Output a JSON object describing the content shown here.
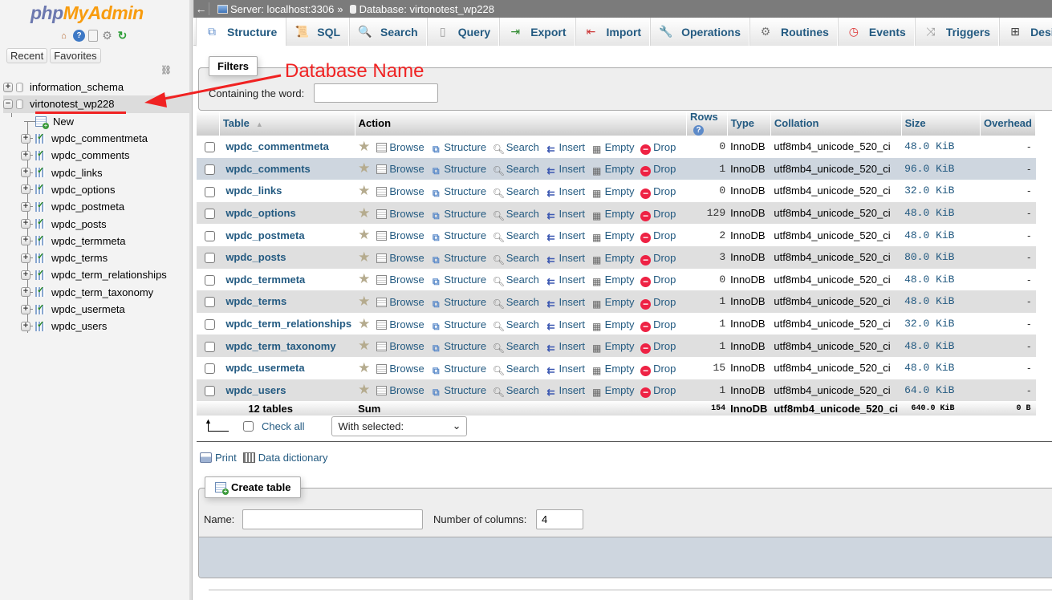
{
  "nav": {
    "logo_php": "php",
    "logo_myadmin": "MyAdmin",
    "icons": [
      "home-icon",
      "help-icon",
      "docs-icon",
      "settings-gear-icon",
      "reload-icon"
    ],
    "tabs": {
      "recent": "Recent",
      "favorites": "Favorites"
    },
    "databases": [
      {
        "name": "information_schema",
        "expanded": false
      },
      {
        "name": "virtonotest_wp228",
        "expanded": true,
        "selected": true
      }
    ],
    "new_label": "New",
    "tables": [
      "wpdc_commentmeta",
      "wpdc_comments",
      "wpdc_links",
      "wpdc_options",
      "wpdc_postmeta",
      "wpdc_posts",
      "wpdc_termmeta",
      "wpdc_terms",
      "wpdc_term_relationships",
      "wpdc_term_taxonomy",
      "wpdc_usermeta",
      "wpdc_users"
    ]
  },
  "breadcrumb": {
    "back": "←",
    "server": "Server: localhost:3306",
    "separator": "»",
    "database": "Database: virtonotest_wp228"
  },
  "tabs": [
    {
      "label": "Structure",
      "icon": "⧉",
      "active": true
    },
    {
      "label": "SQL",
      "icon": "📜"
    },
    {
      "label": "Search",
      "icon": "🔍"
    },
    {
      "label": "Query",
      "icon": "▯"
    },
    {
      "label": "Export",
      "icon": "⇥"
    },
    {
      "label": "Import",
      "icon": "⇤"
    },
    {
      "label": "Operations",
      "icon": "🔧"
    },
    {
      "label": "Routines",
      "icon": "⚙"
    },
    {
      "label": "Events",
      "icon": "◷"
    },
    {
      "label": "Triggers",
      "icon": "⤨"
    },
    {
      "label": "Designer",
      "icon": "⊞"
    }
  ],
  "filters": {
    "legend": "Filters",
    "label": "Containing the word:",
    "value": ""
  },
  "table": {
    "headers": {
      "table": "Table",
      "sort_indicator": "▲",
      "action": "Action",
      "rows": "Rows",
      "rows_help": "?",
      "type": "Type",
      "collation": "Collation",
      "size": "Size",
      "overhead": "Overhead"
    },
    "actions": {
      "browse": "Browse",
      "structure": "Structure",
      "search": "Search",
      "insert": "Insert",
      "empty": "Empty",
      "drop": "Drop"
    },
    "rows": [
      {
        "name": "wpdc_commentmeta",
        "rows": "0",
        "type": "InnoDB",
        "collation": "utf8mb4_unicode_520_ci",
        "size": "48.0 KiB",
        "overhead": "-"
      },
      {
        "name": "wpdc_comments",
        "rows": "1",
        "type": "InnoDB",
        "collation": "utf8mb4_unicode_520_ci",
        "size": "96.0 KiB",
        "overhead": "-"
      },
      {
        "name": "wpdc_links",
        "rows": "0",
        "type": "InnoDB",
        "collation": "utf8mb4_unicode_520_ci",
        "size": "32.0 KiB",
        "overhead": "-"
      },
      {
        "name": "wpdc_options",
        "rows": "129",
        "type": "InnoDB",
        "collation": "utf8mb4_unicode_520_ci",
        "size": "48.0 KiB",
        "overhead": "-"
      },
      {
        "name": "wpdc_postmeta",
        "rows": "2",
        "type": "InnoDB",
        "collation": "utf8mb4_unicode_520_ci",
        "size": "48.0 KiB",
        "overhead": "-"
      },
      {
        "name": "wpdc_posts",
        "rows": "3",
        "type": "InnoDB",
        "collation": "utf8mb4_unicode_520_ci",
        "size": "80.0 KiB",
        "overhead": "-"
      },
      {
        "name": "wpdc_termmeta",
        "rows": "0",
        "type": "InnoDB",
        "collation": "utf8mb4_unicode_520_ci",
        "size": "48.0 KiB",
        "overhead": "-"
      },
      {
        "name": "wpdc_terms",
        "rows": "1",
        "type": "InnoDB",
        "collation": "utf8mb4_unicode_520_ci",
        "size": "48.0 KiB",
        "overhead": "-"
      },
      {
        "name": "wpdc_term_relationships",
        "rows": "1",
        "type": "InnoDB",
        "collation": "utf8mb4_unicode_520_ci",
        "size": "32.0 KiB",
        "overhead": "-"
      },
      {
        "name": "wpdc_term_taxonomy",
        "rows": "1",
        "type": "InnoDB",
        "collation": "utf8mb4_unicode_520_ci",
        "size": "48.0 KiB",
        "overhead": "-"
      },
      {
        "name": "wpdc_usermeta",
        "rows": "15",
        "type": "InnoDB",
        "collation": "utf8mb4_unicode_520_ci",
        "size": "48.0 KiB",
        "overhead": "-"
      },
      {
        "name": "wpdc_users",
        "rows": "1",
        "type": "InnoDB",
        "collation": "utf8mb4_unicode_520_ci",
        "size": "64.0 KiB",
        "overhead": "-"
      }
    ],
    "hover_row_index": 1,
    "summary": {
      "count": "12 tables",
      "label": "Sum",
      "rows": "154",
      "type": "InnoDB",
      "collation": "utf8mb4_unicode_520_ci",
      "size": "640.0 KiB",
      "overhead": "0 B"
    }
  },
  "bulk": {
    "check_all": "Check all",
    "with_selected": "With selected:"
  },
  "links": {
    "print": "Print",
    "data_dictionary": "Data dictionary"
  },
  "create_table": {
    "legend": "Create table",
    "name_label": "Name:",
    "name_value": "",
    "columns_label": "Number of columns:",
    "columns_value": "4"
  },
  "annotation": {
    "text": "Database Name",
    "color": "#f02222"
  },
  "colors": {
    "link": "#235a81",
    "hover_row": "#ced6df",
    "stripe": "#dfdfdf",
    "server_bar": "#7b7b7b",
    "logo_php": "#6c78af",
    "logo_myadmin": "#f89c0e"
  }
}
